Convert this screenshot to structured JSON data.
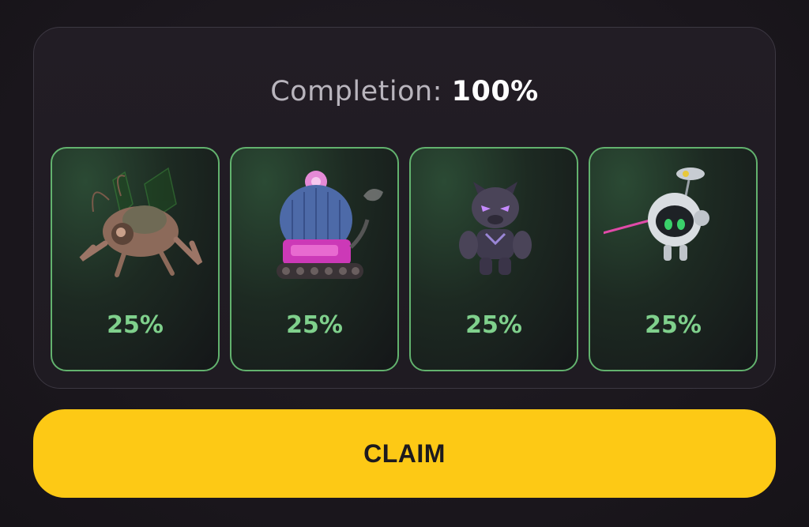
{
  "completion": {
    "label": "Completion:",
    "value": "100%"
  },
  "cards": [
    {
      "name": "bug-mech-character",
      "percent": "25%"
    },
    {
      "name": "cactus-tank-character",
      "percent": "25%"
    },
    {
      "name": "panther-character",
      "percent": "25%"
    },
    {
      "name": "robot-drone-character",
      "percent": "25%"
    }
  ],
  "claim_button": {
    "label": "CLAIM"
  },
  "colors": {
    "accent_yellow": "#fdc915",
    "card_border_green": "#62b26e",
    "percent_green": "#7fd08c"
  }
}
